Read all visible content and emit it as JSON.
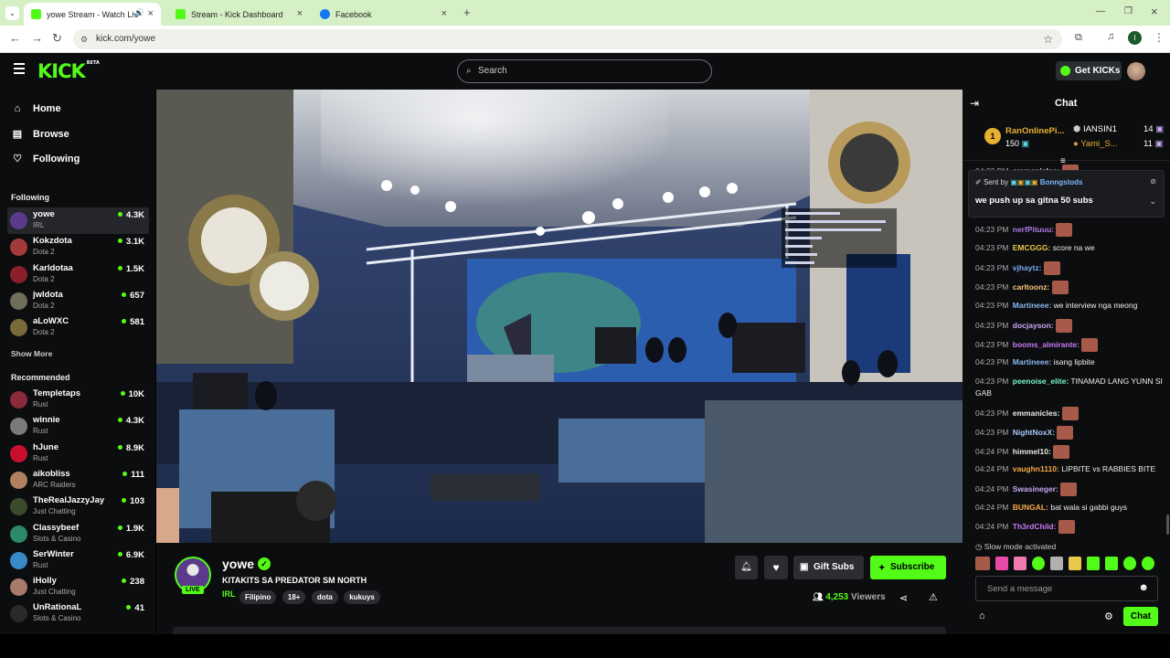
{
  "browser": {
    "tabs": [
      {
        "title": "yowe Stream - Watch Live o",
        "active": true
      },
      {
        "title": "Stream - Kick Dashboard",
        "active": false
      },
      {
        "title": "Facebook",
        "active": false
      }
    ],
    "new_tab": "+",
    "url": "kick.com/yowe",
    "profile_initial": "I"
  },
  "header": {
    "logo": "KICK",
    "logo_badge": "BETA",
    "search_placeholder": "Search",
    "get_kicks": "Get KICKs"
  },
  "sidebar": {
    "nav": [
      {
        "label": "Home",
        "icon": "home-icon"
      },
      {
        "label": "Browse",
        "icon": "browse-icon"
      },
      {
        "label": "Following",
        "icon": "heart-icon"
      }
    ],
    "following_title": "Following",
    "following": [
      {
        "name": "yowe",
        "category": "IRL",
        "viewers": "4.3K",
        "color": "#5b3a8c"
      },
      {
        "name": "Kokzdota",
        "category": "Dota 2",
        "viewers": "3.1K",
        "color": "#a23a3a"
      },
      {
        "name": "Karldotaa",
        "category": "Dota 2",
        "viewers": "1.5K",
        "color": "#8a1f2a"
      },
      {
        "name": "jwldota",
        "category": "Dota 2",
        "viewers": "657",
        "color": "#6e6e5a"
      },
      {
        "name": "aLoWXC",
        "category": "Dota 2",
        "viewers": "581",
        "color": "#7a6a3a"
      }
    ],
    "show_more": "Show More",
    "recommended_title": "Recommended",
    "recommended": [
      {
        "name": "Templetaps",
        "category": "Rust",
        "viewers": "10K",
        "color": "#8a2a3a"
      },
      {
        "name": "winnie",
        "category": "Rust",
        "viewers": "4.3K",
        "color": "#7a7a7a"
      },
      {
        "name": "hJune",
        "category": "Rust",
        "viewers": "8.9K",
        "color": "#c8102e"
      },
      {
        "name": "aikobliss",
        "category": "ARC Raiders",
        "viewers": "111",
        "color": "#b08060"
      },
      {
        "name": "TheRealJazzyJay",
        "category": "Just Chatting",
        "viewers": "103",
        "color": "#3a4a2a"
      },
      {
        "name": "Classybeef",
        "category": "Slots & Casino",
        "viewers": "1.9K",
        "color": "#2a8a6a"
      },
      {
        "name": "SerWinter",
        "category": "Rust",
        "viewers": "6.9K",
        "color": "#3a8ac8"
      },
      {
        "name": "iHolly",
        "category": "Just Chatting",
        "viewers": "238",
        "color": "#a87a6a"
      },
      {
        "name": "UnRationaL",
        "category": "Slots & Casino",
        "viewers": "41",
        "color": "#2a2a2a"
      }
    ]
  },
  "stream": {
    "streamer": "yowe",
    "title": "KITAKITS SA PREDATOR SM NORTH",
    "category": "IRL",
    "tags": [
      "Filipino",
      "18+",
      "dota",
      "kukuys"
    ],
    "live_badge": "LIVE",
    "viewers": "4,253",
    "viewers_label": "Viewers",
    "gift_subs": "Gift Subs",
    "subscribe": "Subscribe"
  },
  "chat": {
    "title": "Chat",
    "leaderboard": {
      "first_name": "RanOnlinePi...",
      "first_points": "150",
      "first_rank": "1",
      "others": [
        {
          "name": "IANSIN1",
          "points": "14"
        },
        {
          "name": "Yami_S...",
          "points": "11"
        }
      ]
    },
    "pinned": {
      "sent_by": "Sent by",
      "sender": "Bonngstods",
      "message": "we push up sa gitna 50 subs"
    },
    "messages": [
      {
        "time": "04:23 PM",
        "user": "emmanicles",
        "color": "#e8e8e8",
        "text": "",
        "emote": true
      },
      {
        "time": "04:23 PM",
        "user": "nerfPituuu",
        "color": "#b07ae8",
        "text": "",
        "emote": true
      },
      {
        "time": "04:23 PM",
        "user": "EMCGGG",
        "color": "#e8c84a",
        "text": "score na we",
        "emote": false
      },
      {
        "time": "04:23 PM",
        "user": "vjhaytz",
        "color": "#7aa8f8",
        "text": "",
        "emote": true
      },
      {
        "time": "04:23 PM",
        "user": "carltoonz",
        "color": "#f8c87a",
        "text": "",
        "emote": true
      },
      {
        "time": "04:23 PM",
        "user": "Martineee",
        "color": "#8ab8f0",
        "text": "we interview nga meong",
        "emote": false
      },
      {
        "time": "04:23 PM",
        "user": "docjayson",
        "color": "#c8a8f8",
        "text": "",
        "emote": true
      },
      {
        "time": "04:23 PM",
        "user": "booms_almirante",
        "color": "#c87af8",
        "text": "",
        "emote": true
      },
      {
        "time": "04:23 PM",
        "user": "Martineee",
        "color": "#8ab8f0",
        "text": "isang lipbite",
        "emote": false
      },
      {
        "time": "04:23 PM",
        "user": "peenoise_elite",
        "color": "#7af8c8",
        "text": "TINAMAD LANG YUNN SI GAB",
        "emote": false
      },
      {
        "time": "04:23 PM",
        "user": "emmanicles",
        "color": "#e8e8e8",
        "text": "",
        "emote": true
      },
      {
        "time": "04:23 PM",
        "user": "NightNoxX",
        "color": "#a8c8f8",
        "text": "",
        "emote": true
      },
      {
        "time": "04:24 PM",
        "user": "himmel10",
        "color": "#e8e8e8",
        "text": "",
        "emote": true
      },
      {
        "time": "04:24 PM",
        "user": "vaughn1110",
        "color": "#f8a84a",
        "text": "LIPBITE vs RABBIES BITE",
        "emote": false
      },
      {
        "time": "04:24 PM",
        "user": "Swasineger",
        "color": "#c8a8f8",
        "text": "",
        "emote": true
      },
      {
        "time": "04:24 PM",
        "user": "BUNGAL",
        "color": "#f8a84a",
        "text": "bat wala si gabbi guys",
        "emote": false
      },
      {
        "time": "04:24 PM",
        "user": "Th3rdChild",
        "color": "#c87af8",
        "text": "",
        "emote": true
      }
    ],
    "slow_mode": "Slow mode activated",
    "input_placeholder": "Send a message",
    "send_button": "Chat"
  },
  "colors": {
    "accent": "#53fc18",
    "bg": "#0c0d0e"
  }
}
